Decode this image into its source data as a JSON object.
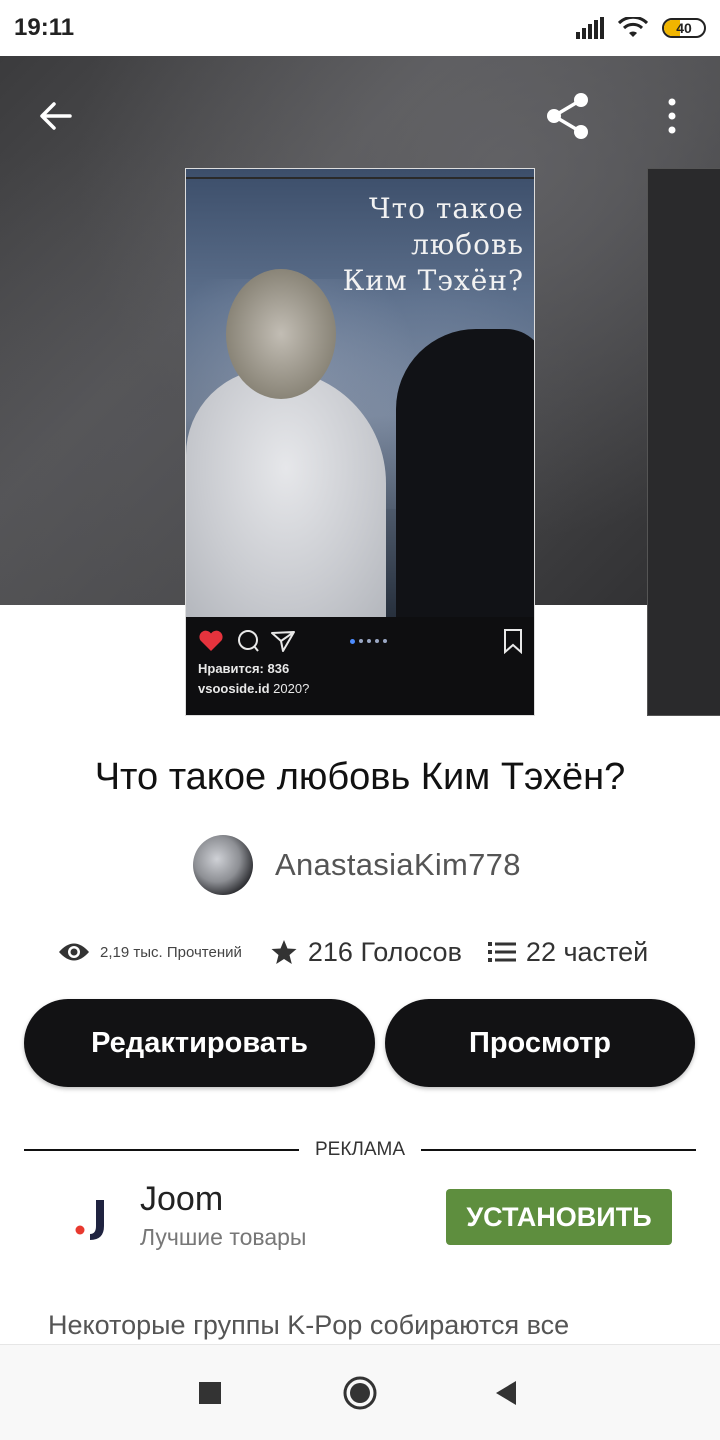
{
  "status_bar": {
    "time": "19:11",
    "battery": "40",
    "battery_level": 0.4
  },
  "header": {
    "back_icon": "arrow-left-icon",
    "share_icon": "share-icon",
    "more_icon": "more-vertical-icon"
  },
  "cover": {
    "title": "Что такое любовь Ким Тэхён?",
    "title_line1": "Что такое",
    "title_line2": "любовь",
    "title_line3": "Ким Тэхён?",
    "likes": "Нравится: 836",
    "caption_user": "vsooside.id",
    "caption_text": "2020?"
  },
  "story": {
    "title": "Что такое любовь Ким Тэхён?",
    "author": "AnastasiaKim778",
    "reads": "2,19 тыс. Прочтений",
    "votes": "216 Голосов",
    "parts": "22 частей"
  },
  "actions": {
    "edit_label": "Редактировать",
    "view_label": "Просмотр"
  },
  "ad": {
    "section_label": "РЕКЛАМА",
    "name": "Joom",
    "subtitle": "Лучшие товары",
    "install_label": "УСТАНОВИТЬ",
    "button_color": "#5e8e3e"
  },
  "description": {
    "text": "Некоторые группы K-Pop собираются все"
  },
  "nav": {
    "recents_icon": "square-icon",
    "home_icon": "circle-icon",
    "back_icon": "triangle-back-icon"
  }
}
